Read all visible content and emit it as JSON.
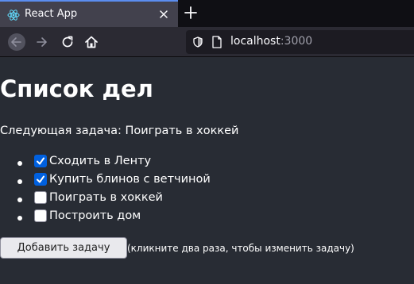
{
  "browser": {
    "tab_title": "React App",
    "url_host": "localhost",
    "url_port": ":3000",
    "accent_color": "#5b8def",
    "icons": [
      "react-icon",
      "close-icon",
      "plus-icon",
      "back-arrow-icon",
      "forward-arrow-icon",
      "reload-icon",
      "home-icon",
      "shield-icon",
      "page-icon"
    ]
  },
  "app": {
    "title": "Список дел",
    "next_task_line": "Следующая задача: Поиграть в хоккей",
    "todos": [
      {
        "label": "Сходить в Ленту",
        "done": true
      },
      {
        "label": "Купить блинов с ветчиной",
        "done": true
      },
      {
        "label": "Поиграть в хоккей",
        "done": false
      },
      {
        "label": "Построить дом",
        "done": false
      }
    ],
    "add_button_label": "Добавить задачу",
    "hint": "(кликните два раза, чтобы изменить задачу)",
    "background_color": "#282c34",
    "checkbox_checked_color": "#0060df"
  }
}
